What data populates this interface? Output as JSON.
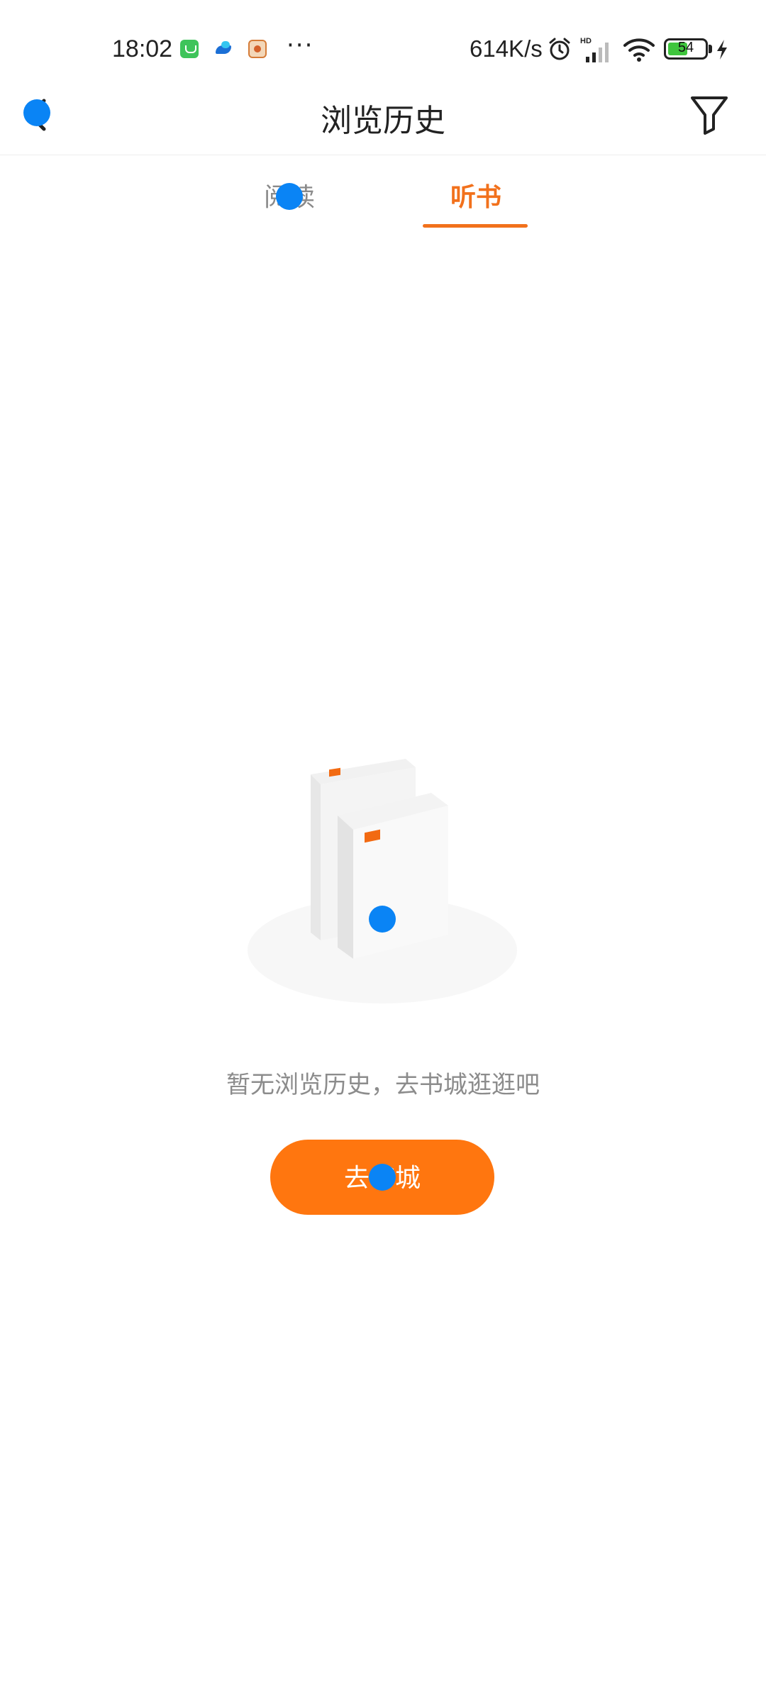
{
  "status_bar": {
    "time": "18:02",
    "more": "···",
    "net_speed": "614K/s",
    "battery_level": "54",
    "hd_label": "HD",
    "battery_percent": 54,
    "icons": [
      "wechat-like-app-icon",
      "blue-app-icon",
      "tiger-app-icon",
      "alarm-icon",
      "hd-signal-icon",
      "wifi-icon",
      "battery-icon",
      "charging-icon"
    ]
  },
  "header": {
    "title": "浏览历史",
    "back_icon": "back-arrow-icon",
    "filter_icon": "filter-icon"
  },
  "tabs": [
    {
      "label": "阅读",
      "active": false
    },
    {
      "label": "听书",
      "active": true
    }
  ],
  "empty_state": {
    "message": "暂无浏览历史，去书城逛逛吧",
    "button_label": "去书城",
    "illustration": "books-illustration"
  },
  "colors": {
    "accent": "#f2711c",
    "button": "#ff760f",
    "touch_indicator": "#0a84f5"
  }
}
